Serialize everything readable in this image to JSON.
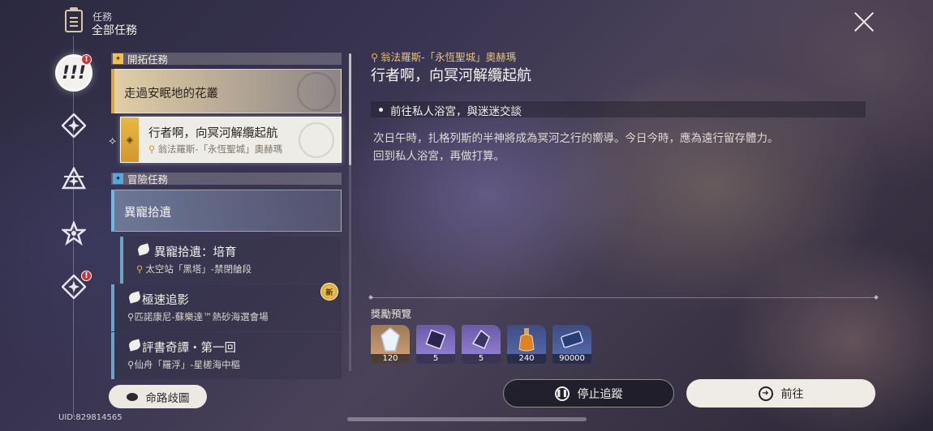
{
  "header": {
    "subtitle": "任務",
    "title": "全部任務"
  },
  "rail": {
    "categories": [
      {
        "name": "all-quests",
        "badge": "!"
      },
      {
        "name": "trailblaze"
      },
      {
        "name": "companion"
      },
      {
        "name": "adventure"
      },
      {
        "name": "daily",
        "badge": "!"
      }
    ]
  },
  "sections": {
    "trailblaze": {
      "label": "開拓任務"
    },
    "adventure": {
      "label": "冒險任務"
    }
  },
  "quests": {
    "q1": {
      "title": "走過安眠地的花叢"
    },
    "q2": {
      "title": "行者啊，向冥河解纜起航",
      "location": "翁法羅斯-「永恆聖城」奧赫瑪"
    },
    "group": {
      "title": "異寵拾遺"
    },
    "q3": {
      "title": "異寵拾遺：培育",
      "location": "太空站「黑塔」-禁閉艙段"
    },
    "q4": {
      "title": "極速追影",
      "location": "匹諾康尼-蘇樂達™熱砂海選會場",
      "badge": "新"
    },
    "q5": {
      "title": "評書奇譚・第一回",
      "location": "仙舟「羅浮」-星槎海中樞"
    }
  },
  "map_button": "命路歧圖",
  "uid": "UID:829814565",
  "detail": {
    "location": "翁法羅斯-「永恆聖城」奧赫瑪",
    "title": "行者啊，向冥河解纜起航",
    "objective": "前往私人浴宮，與迷迷交談",
    "description_line1": "次日午時，扎格列斯的半神將成為冥河之行的嚮導。今日今時，應為遠行留存體力。",
    "description_line2": "回到私人浴宮，再做打算。",
    "rewards_label": "獎勵預覽",
    "rewards": [
      {
        "icon": "stellar-jade-icon",
        "qty": "120"
      },
      {
        "icon": "purple-material-icon",
        "qty": "5"
      },
      {
        "icon": "relic-material-icon",
        "qty": "5"
      },
      {
        "icon": "exp-material-icon",
        "qty": "240"
      },
      {
        "icon": "credits-icon",
        "qty": "90000"
      }
    ],
    "stop_tracking": "停止追蹤",
    "go": "前往"
  },
  "colors": {
    "gold": "#d9a83a",
    "blue": "#6fb8e6",
    "badge_red": "#d6312c"
  }
}
